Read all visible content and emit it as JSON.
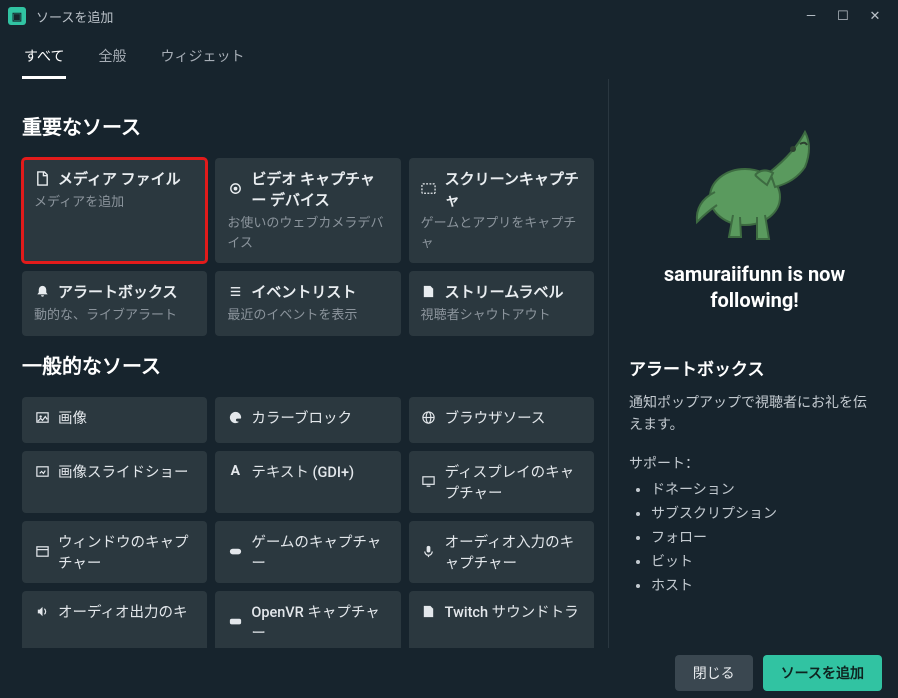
{
  "window": {
    "title": "ソースを追加"
  },
  "tabs": [
    {
      "label": "すべて",
      "active": true
    },
    {
      "label": "全般",
      "active": false
    },
    {
      "label": "ウィジェット",
      "active": false
    }
  ],
  "sections": {
    "important": {
      "title": "重要なソース",
      "cards": [
        {
          "icon": "file",
          "title": "メディア ファイル",
          "sub": "メディアを追加",
          "highlighted": true
        },
        {
          "icon": "webcam",
          "title": "ビデオ キャプチャー デバイス",
          "sub": "お使いのウェブカメラデバイス"
        },
        {
          "icon": "screen",
          "title": "スクリーンキャプチャ",
          "sub": "ゲームとアプリをキャプチャ"
        },
        {
          "icon": "bell",
          "title": "アラートボックス",
          "sub": "動的な、ライブアラート"
        },
        {
          "icon": "list",
          "title": "イベントリスト",
          "sub": "最近のイベントを表示"
        },
        {
          "icon": "label",
          "title": "ストリームラベル",
          "sub": "視聴者シャウトアウト"
        }
      ]
    },
    "general": {
      "title": "一般的なソース",
      "cards": [
        {
          "icon": "image",
          "title": "画像"
        },
        {
          "icon": "palette",
          "title": "カラーブロック"
        },
        {
          "icon": "globe",
          "title": "ブラウザソース"
        },
        {
          "icon": "slideshow",
          "title": "画像スライドショー"
        },
        {
          "icon": "text",
          "title": "テキスト (GDI+)"
        },
        {
          "icon": "display",
          "title": "ディスプレイのキャプチャー"
        },
        {
          "icon": "window",
          "title": "ウィンドウのキャプチャー"
        },
        {
          "icon": "gamepad",
          "title": "ゲームのキャプチャー"
        },
        {
          "icon": "mic",
          "title": "オーディオ入力のキャプチャー"
        },
        {
          "icon": "speaker",
          "title": "オーディオ出力のキ"
        },
        {
          "icon": "vr",
          "title": "OpenVR キャプチャー"
        },
        {
          "icon": "music",
          "title": "Twitch サウンドトラ"
        }
      ]
    }
  },
  "preview": {
    "alert_text": "samuraiifunn is now following!",
    "title": "アラートボックス",
    "description": "通知ポップアップで視聴者にお礼を伝えます。",
    "support_label": "サポート：",
    "support_items": [
      "ドネーション",
      "サブスクリプション",
      "フォロー",
      "ビット",
      "ホスト"
    ]
  },
  "footer": {
    "cancel": "閉じる",
    "ok": "ソースを追加"
  }
}
